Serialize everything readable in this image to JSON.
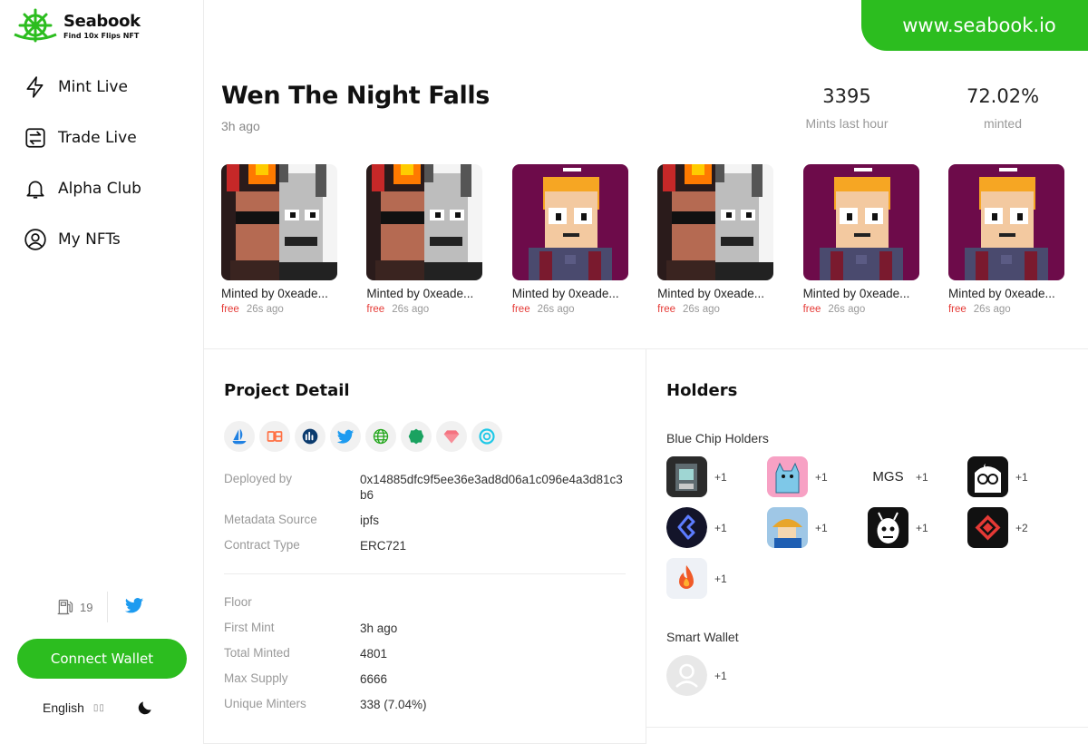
{
  "brand": {
    "name": "Seabook",
    "tagline": "Find 10x Flips NFT",
    "site_url": "www.seabook.io",
    "accent_color": "#2cbd1f"
  },
  "sidebar": {
    "items": [
      {
        "label": "Mint Live",
        "icon": "lightning-icon"
      },
      {
        "label": "Trade Live",
        "icon": "swap-icon"
      },
      {
        "label": "Alpha Club",
        "icon": "bell-icon"
      },
      {
        "label": "My NFTs",
        "icon": "user-circle-icon"
      }
    ],
    "gas_value": "19",
    "connect_label": "Connect Wallet",
    "language": "English",
    "lang_arrows": "▯▯"
  },
  "project": {
    "title": "Wen The Night Falls",
    "time_ago": "3h ago",
    "stats": [
      {
        "value": "3395",
        "label": "Mints last hour"
      },
      {
        "value": "72.02%",
        "label": "minted"
      }
    ],
    "mints": [
      {
        "minted_by": "Minted by 0xeade...",
        "price": "free",
        "ago": "26s ago",
        "art": "split"
      },
      {
        "minted_by": "Minted by 0xeade...",
        "price": "free",
        "ago": "26s ago",
        "art": "split"
      },
      {
        "minted_by": "Minted by 0xeade...",
        "price": "free",
        "ago": "26s ago",
        "art": "purple"
      },
      {
        "minted_by": "Minted by 0xeade...",
        "price": "free",
        "ago": "26s ago",
        "art": "split"
      },
      {
        "minted_by": "Minted by 0xeade...",
        "price": "free",
        "ago": "26s ago",
        "art": "purple"
      },
      {
        "minted_by": "Minted by 0xeade...",
        "price": "free",
        "ago": "26s ago",
        "art": "purple"
      }
    ]
  },
  "detail": {
    "title": "Project Detail",
    "social_icons": [
      "opensea-icon",
      "x2y2-icon",
      "looksrare-icon",
      "twitter-icon",
      "website-icon",
      "etherscan-icon",
      "gem-icon",
      "blur-icon"
    ],
    "rows_top": [
      {
        "key": "Deployed by",
        "value": "0x14885dfc9f5ee36e3ad8d06a1c096e4a3d81c3b6"
      },
      {
        "key": "Metadata Source",
        "value": "ipfs"
      },
      {
        "key": "Contract Type",
        "value": "ERC721"
      }
    ],
    "rows_bottom": [
      {
        "key": "Floor",
        "value": ""
      },
      {
        "key": "First Mint",
        "value": "3h ago"
      },
      {
        "key": "Total Minted",
        "value": "4801"
      },
      {
        "key": "Max Supply",
        "value": "6666"
      },
      {
        "key": "Unique Minters",
        "value": "338 (7.04%)"
      }
    ]
  },
  "holders": {
    "title": "Holders",
    "blue_chip_label": "Blue Chip Holders",
    "blue_chips": [
      {
        "icon": "cryptopunk-collection-icon",
        "count": "+1"
      },
      {
        "icon": "cool-cat-icon",
        "count": "+1"
      },
      {
        "text": "MGS",
        "count": "+1"
      },
      {
        "icon": "moonbird-icon",
        "count": "+1"
      },
      {
        "icon": "lens-icon",
        "count": "+1"
      },
      {
        "icon": "sprout-helmet-icon",
        "count": "+1"
      },
      {
        "icon": "sketch-face-icon",
        "count": "+1"
      },
      {
        "icon": "red-diamond-icon",
        "count": "+2"
      },
      {
        "icon": "flame-icon",
        "count": "+1"
      }
    ],
    "smart_wallet_label": "Smart Wallet",
    "smart_wallet": {
      "icon": "default-avatar-icon",
      "count": "+1"
    }
  }
}
